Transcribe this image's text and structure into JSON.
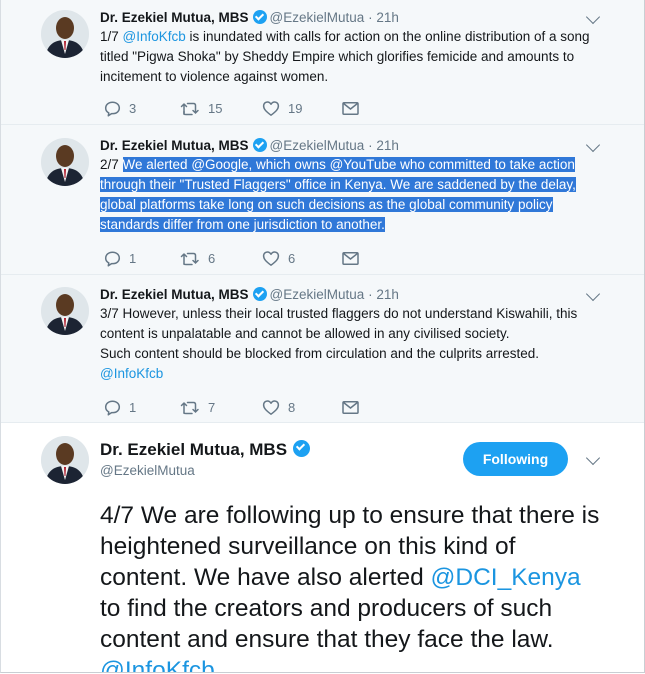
{
  "author": {
    "name": "Dr. Ezekiel Mutua, MBS",
    "handle": "@EzekielMutua",
    "dot": "·"
  },
  "tweets": [
    {
      "time": "21h",
      "prefix": "1/7 ",
      "mention": "@InfoKfcb",
      "body": " is inundated with calls for action on the online distribution of a song titled \"Pigwa Shoka\" by Sheddy Empire which glorifies femicide and amounts to incitement to violence against women.",
      "replies": "3",
      "retweets": "15",
      "likes": "19"
    },
    {
      "time": "21h",
      "prefix": "2/7 ",
      "selected_text": "We alerted @Google, which owns @YouTube who committed to take action through their \"Trusted Flaggers\" office in Kenya. We are saddened by the delay, global platforms take long on such decisions as the global community policy standards differ from one jurisdiction to another.",
      "replies": "1",
      "retweets": "6",
      "likes": "6"
    },
    {
      "time": "21h",
      "line1": "3/7 However, unless their local trusted flaggers do not understand Kiswahili, this content is unpalatable and cannot be allowed in any civilised society.",
      "line2": "Such content should be blocked from circulation and the culprits arrested.",
      "mention": "@InfoKfcb",
      "replies": "1",
      "retweets": "7",
      "likes": "8"
    }
  ],
  "main_tweet": {
    "follow_label": "Following",
    "part1": "4/7 We are following up to ensure that there is heightened surveillance on this kind of content. We have also alerted ",
    "mention": "@DCI_Kenya",
    "part2": " to find the creators and producers of such content and ensure that they face the law. ",
    "mention2": "@InfoKfcb"
  },
  "colors": {
    "accent": "#1da1f2",
    "link": "#1b95e0",
    "selection": "#3078d8",
    "muted": "#657786"
  }
}
